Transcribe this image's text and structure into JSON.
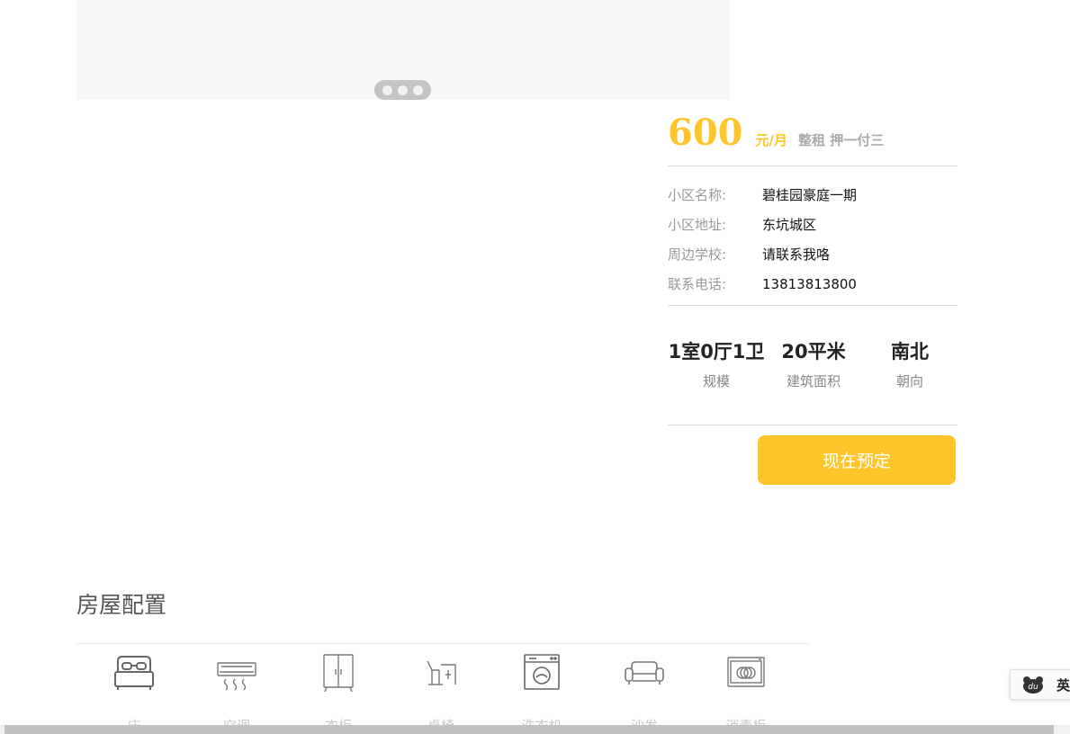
{
  "carousel": {
    "slide_count": 3
  },
  "listing": {
    "price": "600",
    "price_unit": "元/月",
    "rent_type": "整租 押一付三",
    "info": [
      {
        "label": "小区名称:",
        "value": "碧桂园豪庭一期"
      },
      {
        "label": "小区地址:",
        "value": "东坑城区"
      },
      {
        "label": "周边学校:",
        "value": "请联系我咯"
      },
      {
        "label": "联系电话:",
        "value": "13813813800"
      }
    ],
    "stats": [
      {
        "value": "1室0厅1卫",
        "label": "规模"
      },
      {
        "value": "20平米",
        "label": "建筑面积"
      },
      {
        "value": "南北",
        "label": "朝向"
      }
    ],
    "book_button": "现在预定"
  },
  "config": {
    "title": "房屋配置",
    "facilities": [
      {
        "label": "床",
        "icon": "bed-icon"
      },
      {
        "label": "空调",
        "icon": "air-conditioner-icon"
      },
      {
        "label": "衣柜",
        "icon": "wardrobe-icon"
      },
      {
        "label": "桌椅",
        "icon": "desk-chair-icon"
      },
      {
        "label": "洗衣机",
        "icon": "washing-machine-icon"
      },
      {
        "label": "沙发",
        "icon": "sofa-icon"
      },
      {
        "label": "消毒柜",
        "icon": "sterilizer-cabinet-icon"
      }
    ]
  },
  "ime": {
    "mode_label": "英",
    "logo_text": "du"
  },
  "colors": {
    "accent": "#ffc62b",
    "muted": "#999999",
    "carousel_bg": "#f7f7f7"
  }
}
